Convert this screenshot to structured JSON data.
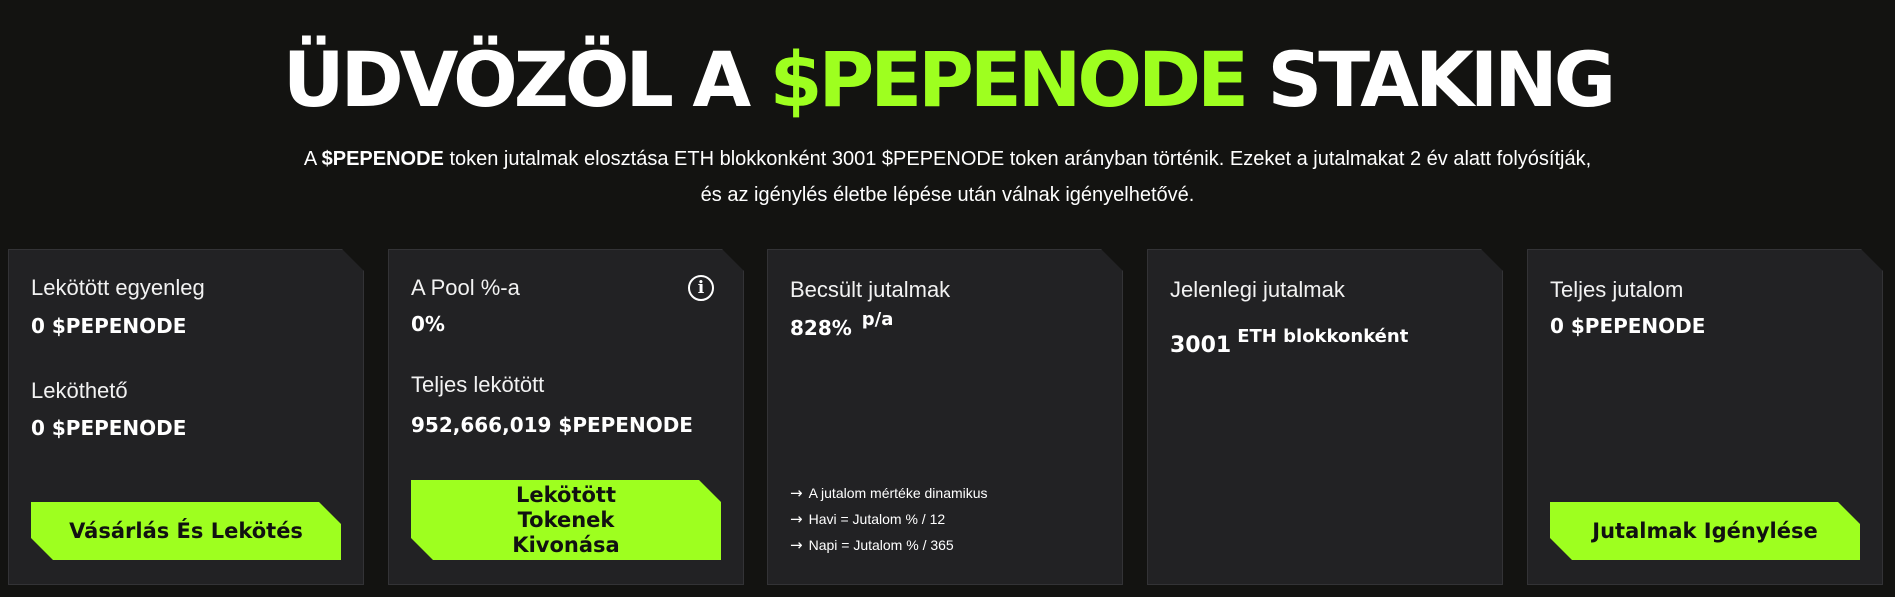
{
  "hero": {
    "title_prefix": "ÜDVÖZÖL A ",
    "title_accent": "$PEPENODE",
    "title_suffix": " STAKING",
    "sub_line1_prefix": "A ",
    "sub_line1_bold": "$PEPENODE",
    "sub_line1_rest": " token jutalmak elosztása ETH blokkonként 3001 $PEPENODE token arányban történik. Ezeket a jutalmakat 2 év alatt folyósítják,",
    "sub_line2": "és az igénylés életbe lépése után válnak igényelhetővé."
  },
  "cards": {
    "staked": {
      "balance_label": "Lekötött egyenleg",
      "balance_value": "0 $PEPENODE",
      "available_label": "Leköthető",
      "available_value": "0 $PEPENODE",
      "button_label": "Vásárlás És Lekötés"
    },
    "pool": {
      "share_label": "A Pool %-a",
      "share_value": "0%",
      "info_icon": "i",
      "total_label": "Teljes lekötött",
      "total_value": "952,666,019 $PEPENODE",
      "button_label": "Lekötött Tokenek Kivonása"
    },
    "estimated": {
      "label": "Becsült jutalmak",
      "value": "828%",
      "unit": "p/a",
      "notes": [
        "A jutalom mértéke dinamikus",
        "Havi = Jutalom % / 12",
        "Napi = Jutalom % / 365"
      ]
    },
    "current": {
      "label": "Jelenlegi jutalmak",
      "value": "3001",
      "unit": "ETH blokkonként"
    },
    "total": {
      "label": "Teljes jutalom",
      "value": "0 $PEPENODE",
      "button_label": "Jutalmak Igénylése"
    }
  },
  "colors": {
    "accent": "#9eff1f",
    "background": "#131311",
    "card": "#222224"
  }
}
